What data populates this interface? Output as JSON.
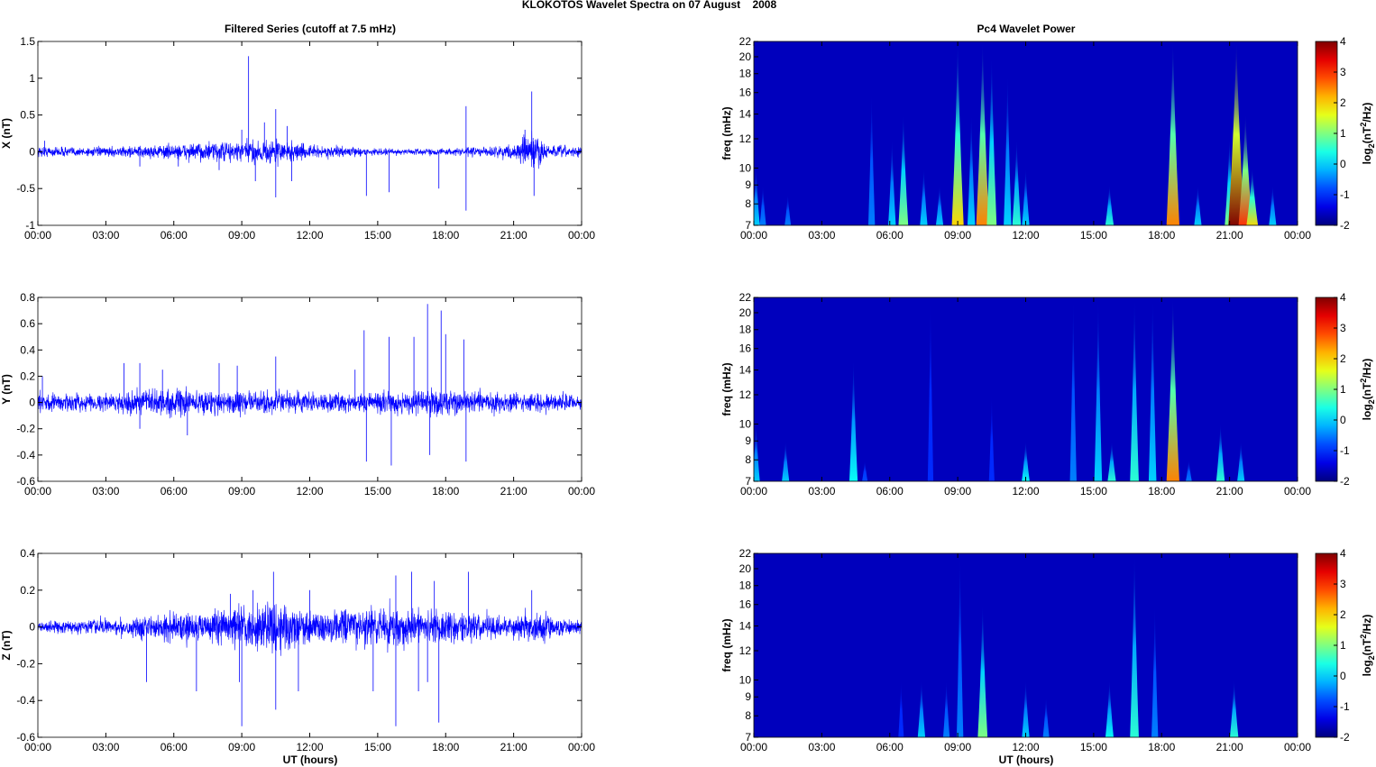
{
  "chart_data": {
    "title": "KLOKOTOS Wavelet Spectra on 07 August    2008",
    "left_title": "Filtered Series (cutoff at 7.5 mHz)",
    "right_title": "Pc4 Wavelet Power",
    "xlabel": "UT (hours)",
    "x_ticks": [
      "00:00",
      "03:00",
      "06:00",
      "09:00",
      "12:00",
      "15:00",
      "18:00",
      "21:00",
      "00:00"
    ],
    "xlim_hours": [
      0,
      24
    ],
    "line_color": "#0000ff",
    "series": [
      {
        "type": "line",
        "name": "X",
        "ylabel": "X (nT)",
        "ylim": [
          -1,
          1.5
        ],
        "y_ticks": [
          "-1",
          "-0.5",
          "0",
          "0.5",
          "1",
          "1.5"
        ],
        "y_tick_values": [
          -1,
          -0.5,
          0,
          0.5,
          1,
          1.5
        ],
        "noise_envelope": [
          [
            0,
            0.05
          ],
          [
            3,
            0.04
          ],
          [
            6,
            0.07
          ],
          [
            9,
            0.1
          ],
          [
            10.5,
            0.12
          ],
          [
            12,
            0.06
          ],
          [
            15,
            0.03
          ],
          [
            18,
            0.03
          ],
          [
            21,
            0.06
          ],
          [
            21.8,
            0.2
          ],
          [
            22.5,
            0.06
          ],
          [
            24,
            0.05
          ]
        ],
        "spikes": [
          [
            0.3,
            0.15
          ],
          [
            4.5,
            -0.2
          ],
          [
            6.2,
            -0.2
          ],
          [
            8.0,
            -0.25
          ],
          [
            9.0,
            0.3
          ],
          [
            9.3,
            1.3
          ],
          [
            9.6,
            -0.4
          ],
          [
            10.0,
            0.4
          ],
          [
            10.5,
            0.58
          ],
          [
            10.5,
            -0.62
          ],
          [
            11.0,
            0.35
          ],
          [
            11.2,
            -0.4
          ],
          [
            14.5,
            -0.6
          ],
          [
            15.5,
            -0.55
          ],
          [
            17.7,
            -0.5
          ],
          [
            18.9,
            0.62
          ],
          [
            18.9,
            -0.8
          ],
          [
            21.8,
            0.82
          ],
          [
            21.9,
            -0.6
          ],
          [
            21.5,
            0.3
          ]
        ]
      },
      {
        "type": "line",
        "name": "Y",
        "ylabel": "Y (nT)",
        "ylim": [
          -0.6,
          0.8
        ],
        "y_ticks": [
          "-0.6",
          "-0.4",
          "-0.2",
          "0",
          "0.2",
          "0.4",
          "0.6",
          "0.8"
        ],
        "y_tick_values": [
          -0.6,
          -0.4,
          -0.2,
          0,
          0.2,
          0.4,
          0.6,
          0.8
        ],
        "noise_envelope": [
          [
            0,
            0.05
          ],
          [
            3,
            0.04
          ],
          [
            4.5,
            0.07
          ],
          [
            9,
            0.06
          ],
          [
            12,
            0.05
          ],
          [
            15,
            0.05
          ],
          [
            17,
            0.07
          ],
          [
            19,
            0.06
          ],
          [
            24,
            0.04
          ]
        ],
        "spikes": [
          [
            0.2,
            0.2
          ],
          [
            3.8,
            0.3
          ],
          [
            4.5,
            0.3
          ],
          [
            4.5,
            -0.2
          ],
          [
            5.5,
            0.25
          ],
          [
            6.6,
            -0.25
          ],
          [
            8.0,
            0.3
          ],
          [
            8.8,
            0.28
          ],
          [
            10.5,
            0.35
          ],
          [
            14.4,
            0.55
          ],
          [
            14.5,
            -0.45
          ],
          [
            15.5,
            0.5
          ],
          [
            15.6,
            -0.48
          ],
          [
            16.6,
            0.5
          ],
          [
            17.2,
            0.75
          ],
          [
            17.3,
            -0.4
          ],
          [
            17.8,
            0.7
          ],
          [
            18.0,
            0.52
          ],
          [
            18.8,
            0.48
          ],
          [
            18.9,
            -0.45
          ],
          [
            14.0,
            0.25
          ]
        ]
      },
      {
        "type": "line",
        "name": "Z",
        "ylabel": "Z (nT)",
        "ylim": [
          -0.6,
          0.4
        ],
        "y_ticks": [
          "-0.6",
          "-0.4",
          "-0.2",
          "0",
          "0.2",
          "0.4"
        ],
        "y_tick_values": [
          -0.6,
          -0.4,
          -0.2,
          0,
          0.2,
          0.4
        ],
        "noise_envelope": [
          [
            0,
            0.02
          ],
          [
            3,
            0.03
          ],
          [
            6,
            0.05
          ],
          [
            9,
            0.07
          ],
          [
            10.5,
            0.1
          ],
          [
            12,
            0.06
          ],
          [
            15,
            0.08
          ],
          [
            18,
            0.06
          ],
          [
            21,
            0.04
          ],
          [
            21.8,
            0.06
          ],
          [
            24,
            0.02
          ]
        ],
        "spikes": [
          [
            4.8,
            -0.3
          ],
          [
            7.0,
            -0.35
          ],
          [
            8.5,
            0.18
          ],
          [
            8.9,
            -0.3
          ],
          [
            9.0,
            -0.54
          ],
          [
            9.5,
            0.2
          ],
          [
            10.4,
            0.3
          ],
          [
            10.5,
            -0.45
          ],
          [
            11.5,
            -0.35
          ],
          [
            12.0,
            0.2
          ],
          [
            14.8,
            -0.35
          ],
          [
            15.8,
            0.28
          ],
          [
            15.8,
            -0.54
          ],
          [
            16.5,
            0.3
          ],
          [
            16.8,
            -0.35
          ],
          [
            17.2,
            -0.3
          ],
          [
            17.5,
            0.25
          ],
          [
            17.7,
            -0.52
          ],
          [
            19.0,
            0.3
          ],
          [
            21.8,
            0.2
          ]
        ]
      }
    ],
    "spectra": [
      {
        "type": "heatmap",
        "name": "X power",
        "ylabel": "freq (mHz)",
        "ylim_mHz": [
          7,
          22
        ],
        "y_scale": "log",
        "y_ticks": [
          "7",
          "8",
          "9",
          "10",
          "12",
          "14",
          "16",
          "18",
          "20",
          "22"
        ],
        "y_tick_values": [
          7,
          8,
          9,
          10,
          12,
          14,
          16,
          18,
          20,
          22
        ],
        "colorbar": {
          "label": "log2(nT^2/Hz)",
          "label_main": "log",
          "label_sub": "2",
          "label_rest_a": "(nT",
          "label_sup": "2",
          "label_rest_b": "/Hz)",
          "ticks": [
            "-2",
            "-1",
            "0",
            "1",
            "2",
            "3",
            "4"
          ],
          "range": [
            -2,
            4
          ]
        },
        "bursts": [
          [
            0.1,
            10,
            0
          ],
          [
            0.4,
            9,
            -0.5
          ],
          [
            1.5,
            8.5,
            -0.5
          ],
          [
            5.2,
            16,
            -0.5
          ],
          [
            6.1,
            12,
            0
          ],
          [
            6.6,
            14,
            1
          ],
          [
            7.5,
            10,
            0
          ],
          [
            8.2,
            9,
            0
          ],
          [
            9.0,
            22,
            2
          ],
          [
            9.6,
            14,
            0
          ],
          [
            10.1,
            22,
            2.5
          ],
          [
            10.5,
            20,
            1
          ],
          [
            11.2,
            18,
            0
          ],
          [
            11.6,
            12,
            0.5
          ],
          [
            12.0,
            10,
            0
          ],
          [
            15.7,
            9,
            0.5
          ],
          [
            18.5,
            22,
            2.5
          ],
          [
            19.6,
            9,
            0
          ],
          [
            21.0,
            12,
            1
          ],
          [
            21.3,
            22,
            4
          ],
          [
            21.7,
            14,
            3
          ],
          [
            22.0,
            10,
            2
          ],
          [
            22.9,
            9,
            0
          ]
        ]
      },
      {
        "type": "heatmap",
        "name": "Y power",
        "ylabel": "freq (mHz)",
        "ylim_mHz": [
          7,
          22
        ],
        "y_scale": "log",
        "y_ticks": [
          "7",
          "8",
          "9",
          "10",
          "12",
          "14",
          "16",
          "18",
          "20",
          "22"
        ],
        "y_tick_values": [
          7,
          8,
          9,
          10,
          12,
          14,
          16,
          18,
          20,
          22
        ],
        "colorbar": {
          "label": "log2(nT^2/Hz)",
          "label_main": "log",
          "label_sub": "2",
          "label_rest_a": "(nT",
          "label_sup": "2",
          "label_rest_b": "/Hz)",
          "ticks": [
            "-2",
            "-1",
            "0",
            "1",
            "2",
            "3",
            "4"
          ],
          "range": [
            -2,
            4
          ]
        },
        "bursts": [
          [
            0.1,
            10,
            0
          ],
          [
            1.4,
            9,
            0
          ],
          [
            4.4,
            15,
            0.3
          ],
          [
            4.9,
            8,
            -0.8
          ],
          [
            7.8,
            22,
            -1
          ],
          [
            10.5,
            12,
            -1
          ],
          [
            12.0,
            9,
            0.3
          ],
          [
            14.1,
            22,
            -0.5
          ],
          [
            15.2,
            22,
            0
          ],
          [
            15.8,
            9,
            0.5
          ],
          [
            16.8,
            22,
            0.5
          ],
          [
            17.6,
            22,
            0
          ],
          [
            18.5,
            22,
            2.5
          ],
          [
            19.2,
            8,
            -0.5
          ],
          [
            20.6,
            10,
            0.5
          ],
          [
            21.5,
            9,
            0
          ]
        ]
      },
      {
        "type": "heatmap",
        "name": "Z power",
        "ylabel": "freq (mHz)",
        "ylim_mHz": [
          7,
          22
        ],
        "y_scale": "log",
        "y_ticks": [
          "7",
          "8",
          "9",
          "10",
          "12",
          "14",
          "16",
          "18",
          "20",
          "22"
        ],
        "y_tick_values": [
          7,
          8,
          9,
          10,
          12,
          14,
          16,
          18,
          20,
          22
        ],
        "colorbar": {
          "label": "log2(nT^2/Hz)",
          "label_main": "log",
          "label_sub": "2",
          "label_rest_a": "(nT",
          "label_sup": "2",
          "label_rest_b": "/Hz)",
          "ticks": [
            "-2",
            "-1",
            "0",
            "1",
            "2",
            "3",
            "4"
          ],
          "range": [
            -2,
            4
          ]
        },
        "bursts": [
          [
            6.5,
            10,
            -1
          ],
          [
            7.4,
            10,
            0
          ],
          [
            8.5,
            10,
            -0.5
          ],
          [
            9.1,
            22,
            -0.5
          ],
          [
            10.1,
            16,
            1
          ],
          [
            12.0,
            10,
            0
          ],
          [
            12.9,
            9,
            -0.5
          ],
          [
            15.7,
            10,
            0.3
          ],
          [
            16.8,
            22,
            0.5
          ],
          [
            17.7,
            16,
            -0.5
          ],
          [
            21.2,
            10,
            0.5
          ]
        ]
      }
    ]
  }
}
